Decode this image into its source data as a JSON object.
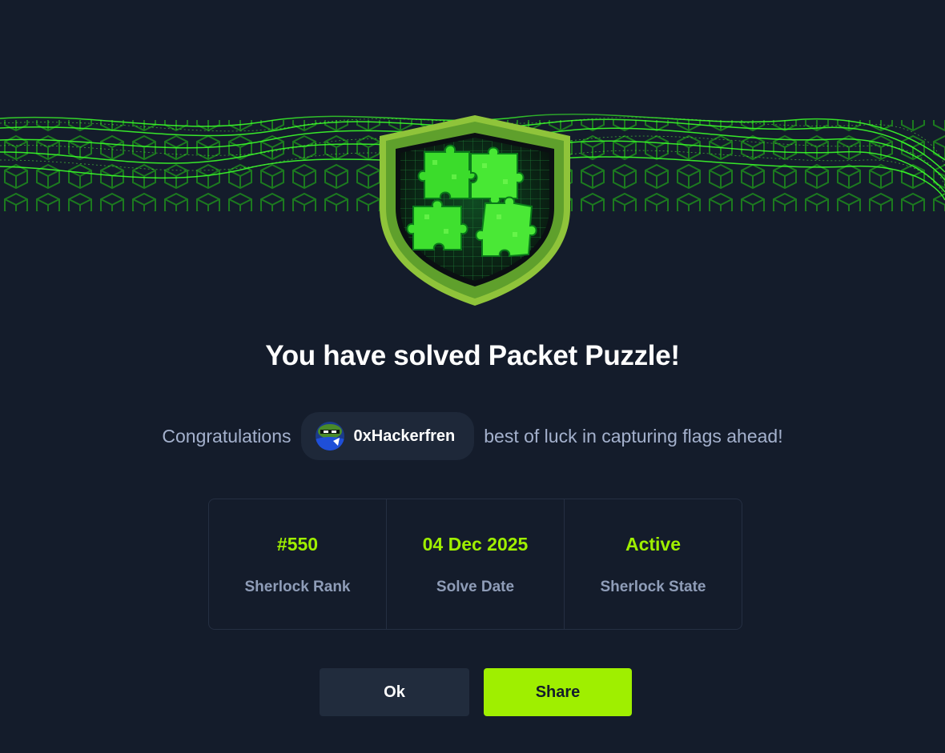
{
  "modal": {
    "title": "You have solved Packet Puzzle!",
    "congrats_prefix": "Congratulations",
    "username": "0xHackerfren",
    "congrats_suffix": "best of luck in capturing flags ahead!"
  },
  "stats": [
    {
      "value": "#550",
      "label": "Sherlock Rank"
    },
    {
      "value": "04 Dec 2025",
      "label": "Solve Date"
    },
    {
      "value": "Active",
      "label": "Sherlock State"
    }
  ],
  "buttons": {
    "ok_label": "Ok",
    "share_label": "Share"
  },
  "colors": {
    "background": "#141c2b",
    "accent": "#9fef00",
    "muted_text": "#a4b1cd",
    "chip_bg": "#1e2839",
    "ok_button_bg": "#212c3d"
  },
  "icons": {
    "badge": "puzzle-shield-icon",
    "avatar": "user-avatar-icon"
  }
}
